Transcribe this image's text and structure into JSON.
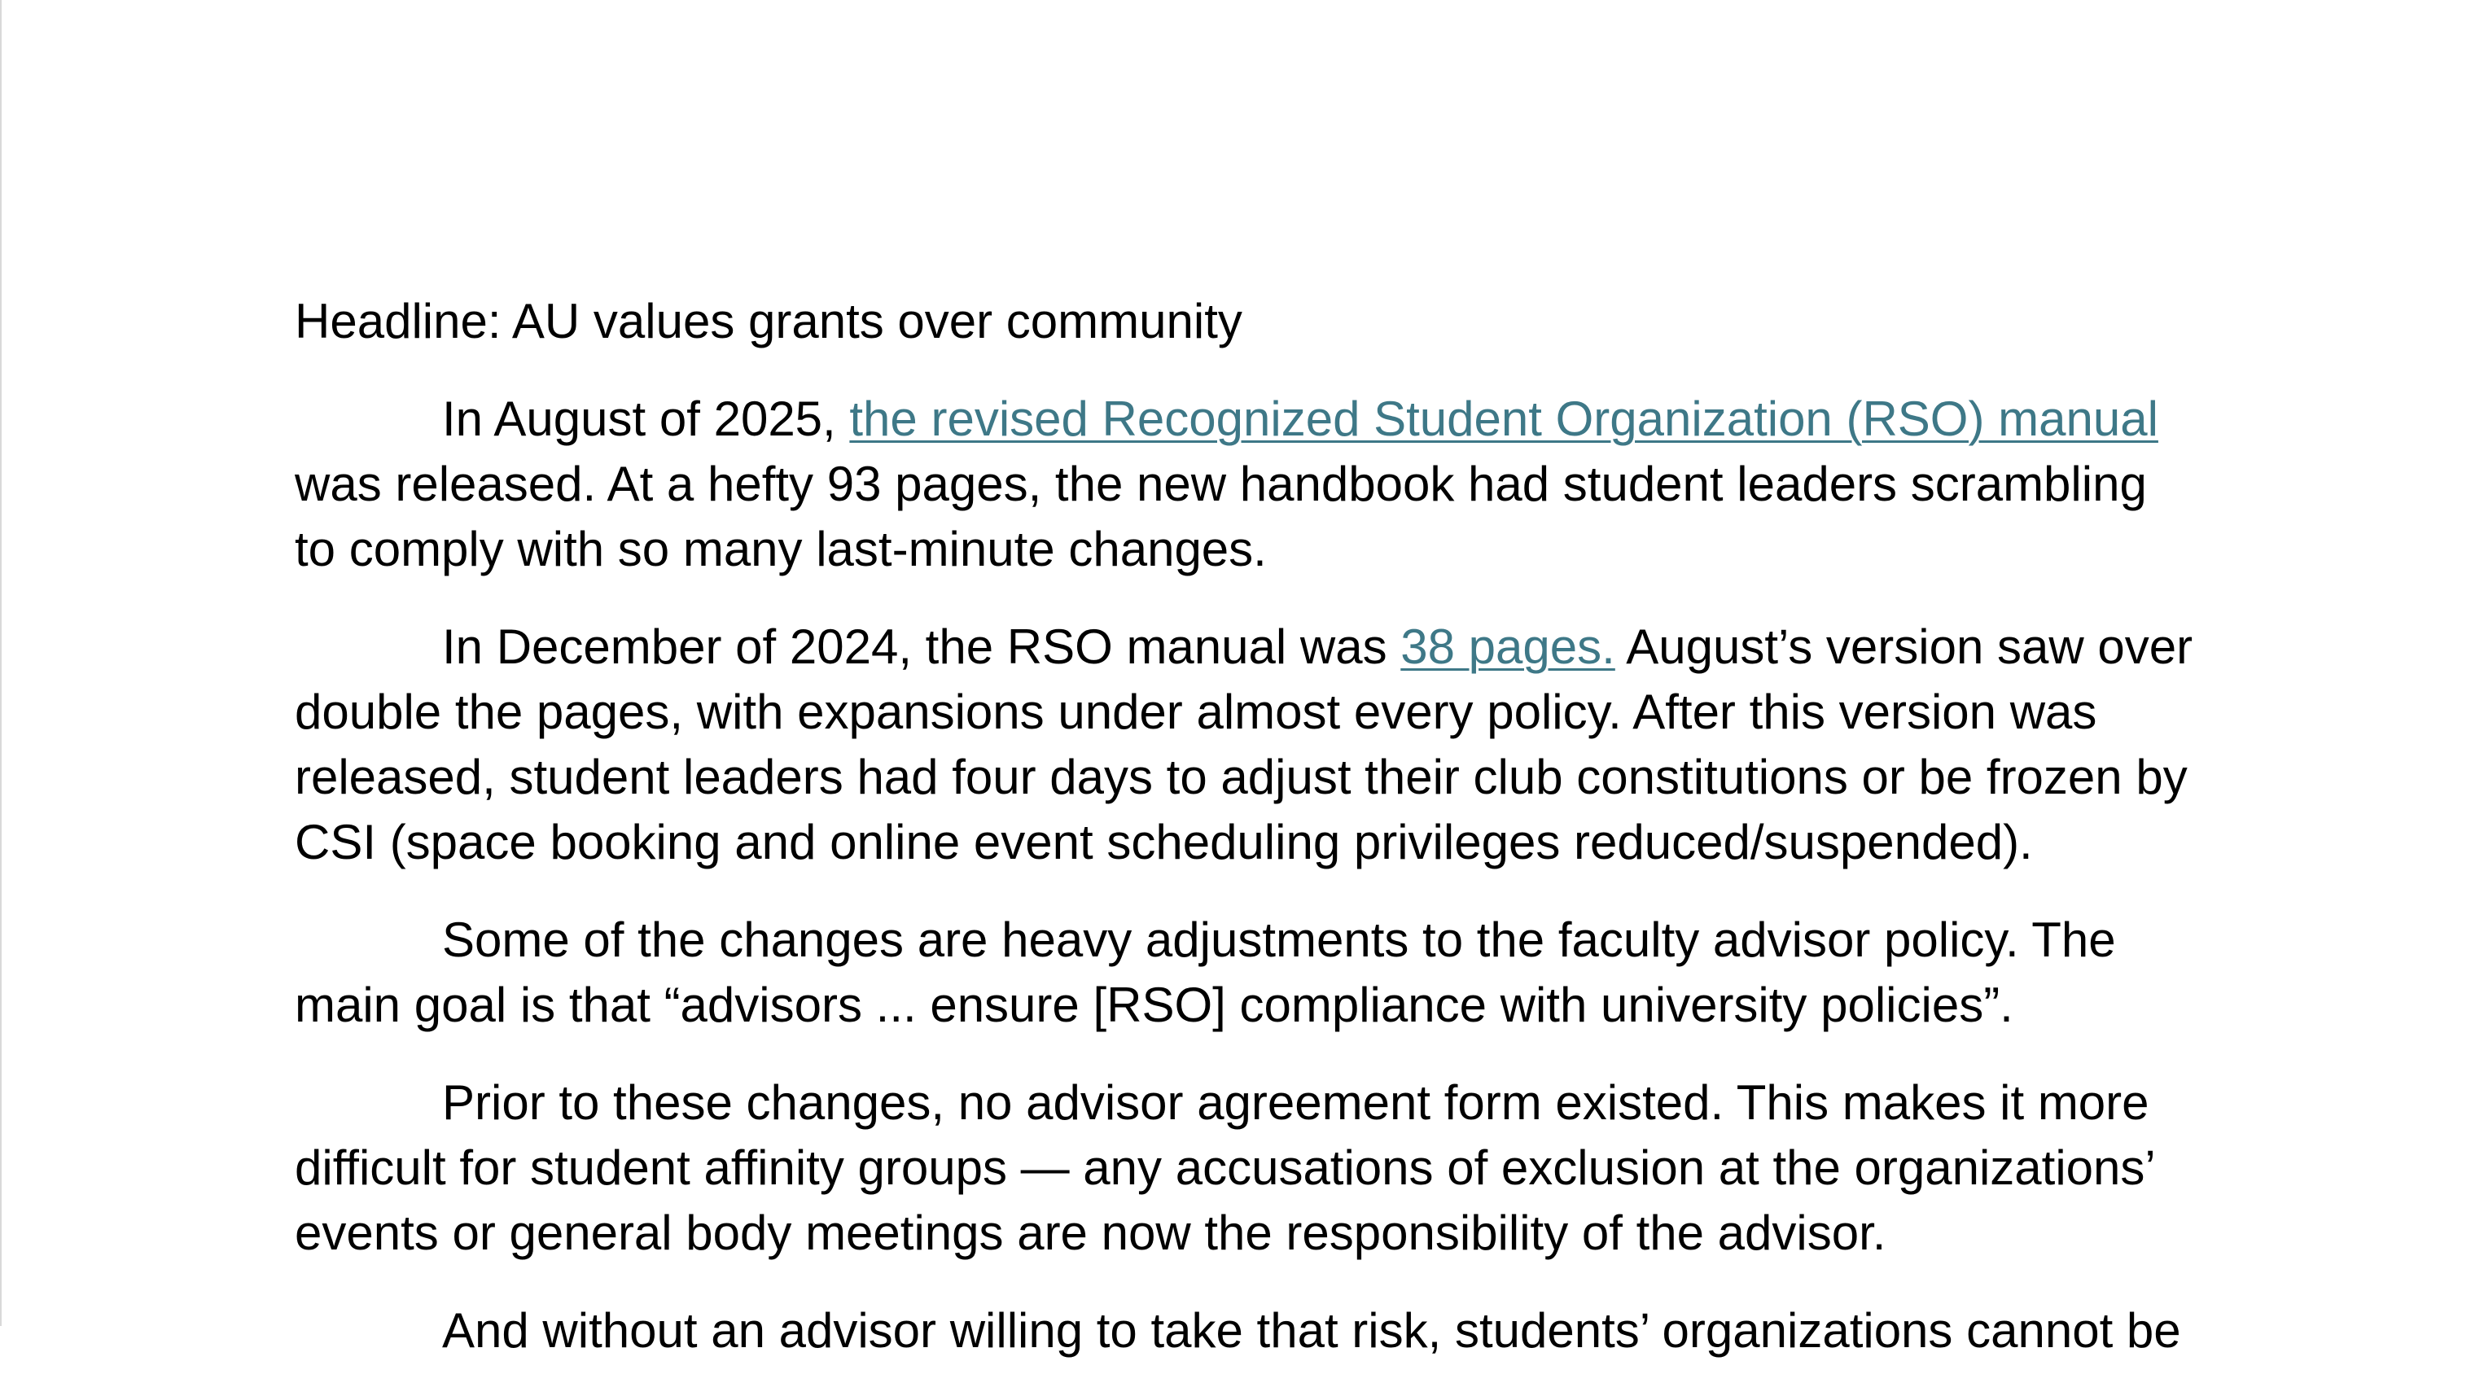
{
  "colors": {
    "link": "#3e7887",
    "text": "#000000",
    "background": "#ffffff"
  },
  "document": {
    "headline": "Headline: AU values grants over community",
    "paragraphs": [
      {
        "before": "In August of 2025, ",
        "link": "the revised Recognized Student Organization (RSO) manual",
        "after": " was released. At a hefty 93 pages, the new handbook had student leaders scrambling to comply with so many last-minute changes."
      },
      {
        "before": "In December of 2024, the RSO manual was ",
        "link": "38 pages.",
        "after": " August’s version saw over double the pages, with expansions under almost every policy. After this version was released, student leaders had four days to adjust their club constitutions or be frozen by CSI (space booking and online event scheduling privileges reduced/suspended)."
      },
      {
        "text": "Some of the changes are heavy adjustments to the faculty advisor policy. The main goal is that “advisors ... ensure [RSO] compliance with university policies”."
      },
      {
        "text": "Prior to these changes, no advisor agreement form existed. This makes it more difficult for student affinity groups — any accusations of exclusion at the organizations’ events or general body meetings are now the responsibility of the advisor."
      },
      {
        "text": "And without an advisor willing to take that risk, students’ organizations cannot be"
      }
    ]
  }
}
